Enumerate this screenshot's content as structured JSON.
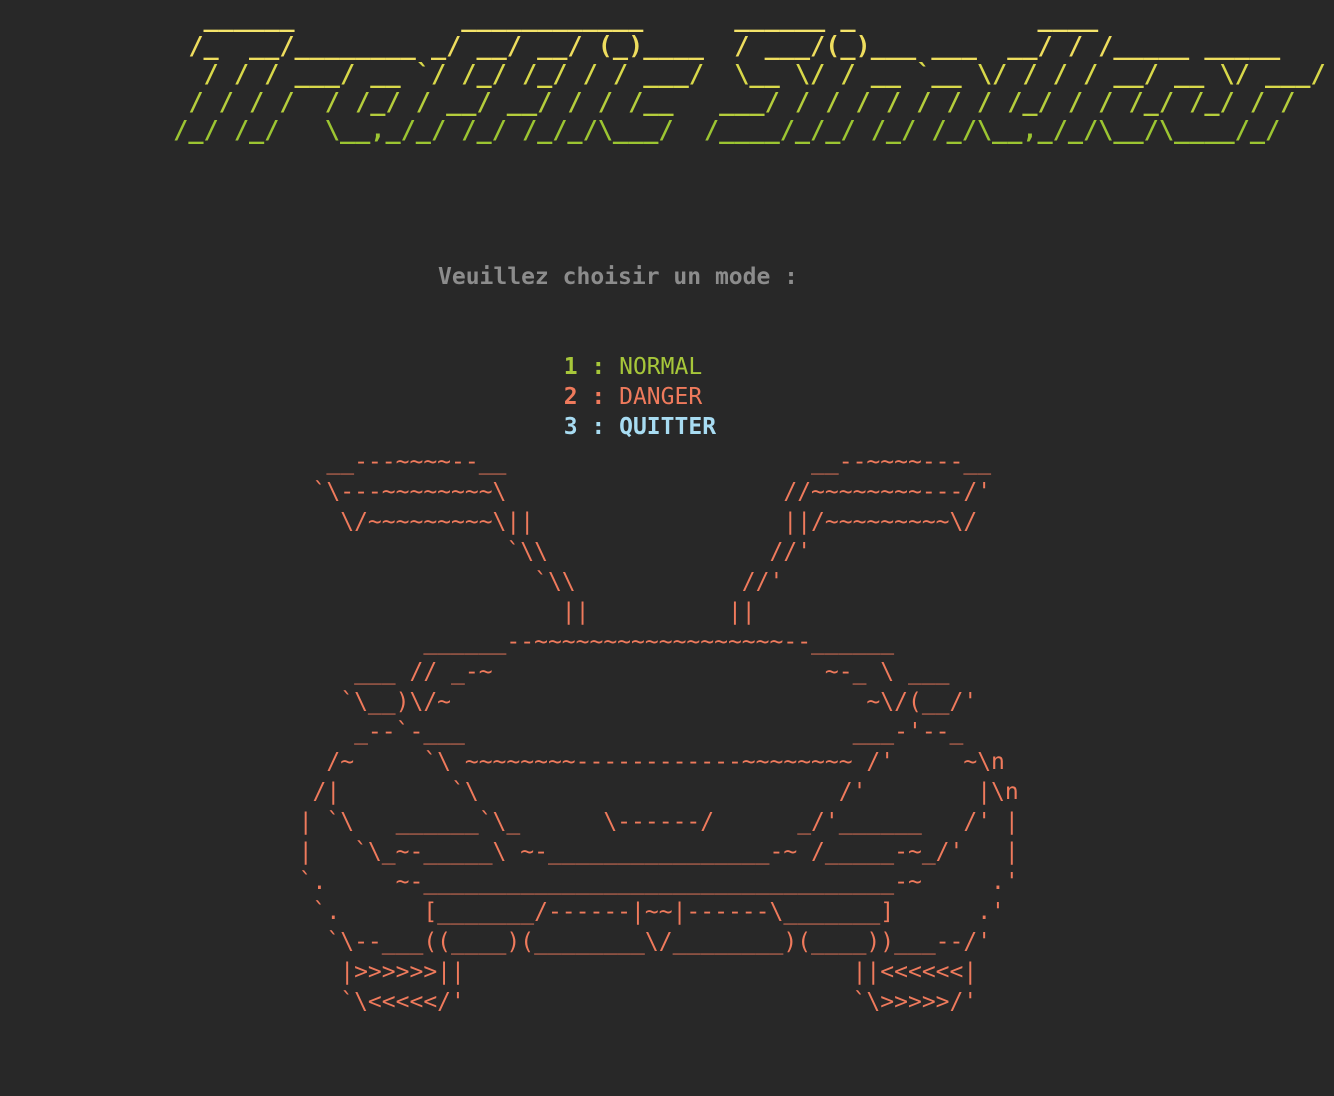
{
  "colors": {
    "background": "#282828",
    "prompt": "#8c8c8c",
    "normal": "#a7c73a",
    "danger": "#ef7a5c",
    "quit": "#a8dcf2",
    "car": "#ef7a5c",
    "banner_top": "#f2e36a",
    "banner_bottom": "#9cc532"
  },
  "banner": {
    "lines": [
      "   ______           ____________      ______ _            ____",
      "  /_  __/________ _/ __/ __/ (_)____  / ___/(_)___ ___  __/ / /_____ _____",
      "   / / / ___/ __ `/ /_/ /_/ / / ___/  \\__ \\/ / __ `__ \\/ / / / __/ __ \\/ ___/",
      "  / / / /  / /_/ / __/ __/ / / /__   ___/ / / / / / / / /_/ / / /_/ /_/ / /",
      " /_/ /_/   \\__,_/_/ /_/ /_/_/\\___/  /____/_/_/ /_/ /_/\\__,_/_/\\__/\\____/_/"
    ]
  },
  "prompt_text": "Veuillez choisir un mode :",
  "menu": [
    {
      "number": "1",
      "separator": " : ",
      "label": "NORMAL"
    },
    {
      "number": "2",
      "separator": " : ",
      "label": "DANGER"
    },
    {
      "number": "3",
      "separator": " : ",
      "label": "QUITTER"
    }
  ],
  "car_art": "    __---~~~~--__                      __--~~~~---__\n   `\\---~~~~~~~~\\                    //~~~~~~~~---/'\n     \\/~~~~~~~~~\\||                  ||/~~~~~~~~~\\/\n                 `\\\\                //'\n                   `\\\\            //'\n                     ||          ||\n           ______--~~~~~~~~~~~~~~~~~~--______\n      ___ // _-~                        ~-_ \\ ___\n     `\\__)\\/~                              ~\\/(__/'\n      _--`-___                            ___-'--_\n    /~     `\\ ~~~~~~~~------------~~~~~~~~ /'     ~\\n\n   /|        `\\                          /'        |\\n\n  | `\\   ______`\\_      \\------/      _/'______   /' |\n  |   `\\_~-_____\\ ~-________________-~ /_____-~_/'   |\n  `.     ~-__________________________________-~     .'\n   `.      [_______/------|~~|------\\_______]      .'\n    `\\--___((____)(________\\/________)(____))___--/'\n     |>>>>>>||                            ||<<<<<<|\n     `\\<<<<</'                            `\\>>>>>/'"
}
